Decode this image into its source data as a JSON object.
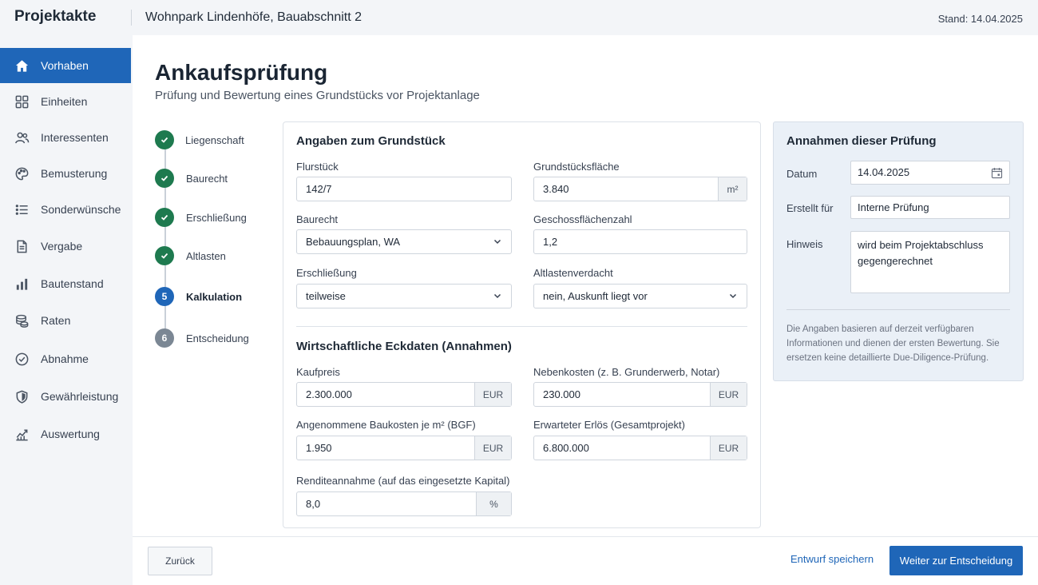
{
  "app": {
    "brand": "Projektakte",
    "project": "Wohnpark Lindenhöfe, Bauabschnitt 2",
    "stand": "Stand: 14.04.2025"
  },
  "sidebar": {
    "items": [
      {
        "label": "Vorhaben",
        "icon": "home-icon"
      },
      {
        "label": "Einheiten",
        "icon": "grid-icon"
      },
      {
        "label": "Interessenten",
        "icon": "users-icon"
      },
      {
        "label": "Bemusterung",
        "icon": "palette-icon"
      },
      {
        "label": "Sonderwünsche",
        "icon": "list-icon"
      },
      {
        "label": "Vergabe",
        "icon": "document-icon"
      },
      {
        "label": "Bautenstand",
        "icon": "bar-chart-icon"
      },
      {
        "label": "Raten",
        "icon": "coins-icon"
      },
      {
        "label": "Abnahme",
        "icon": "check-circle-icon"
      },
      {
        "label": "Gewährleistung",
        "icon": "shield-icon"
      },
      {
        "label": "Auswertung",
        "icon": "trend-icon"
      }
    ],
    "active_index": 0,
    "accent": "#1f66b8"
  },
  "page": {
    "title": "Ankaufsprüfung",
    "subtitle": "Prüfung und Bewertung eines Grundstücks vor Projektanlage"
  },
  "steps": [
    {
      "number": "1",
      "label": "Liegenschaft",
      "state": "done"
    },
    {
      "number": "2",
      "label": "Baurecht",
      "state": "done"
    },
    {
      "number": "3",
      "label": "Erschließung",
      "state": "done"
    },
    {
      "number": "4",
      "label": "Altlasten",
      "state": "done"
    },
    {
      "number": "5",
      "label": "Kalkulation",
      "state": "current"
    },
    {
      "number": "6",
      "label": "Entscheidung",
      "state": "todo"
    }
  ],
  "form": {
    "section1_title": "Angaben zum Grundstück",
    "flurstueck": {
      "label": "Flurstück",
      "value": "142/7"
    },
    "flaeche": {
      "label": "Grundstücksfläche",
      "value": "3.840",
      "unit": "m²"
    },
    "baurecht": {
      "label": "Baurecht",
      "value": "Bebauungsplan, WA"
    },
    "gfz": {
      "label": "Geschossflächenzahl",
      "value": "1,2"
    },
    "erschliessung": {
      "label": "Erschließung",
      "value": "teilweise"
    },
    "altlasten": {
      "label": "Altlastenverdacht",
      "value": "nein, Auskunft liegt vor"
    },
    "section2_title": "Wirtschaftliche Eckdaten (Annahmen)",
    "kaufpreis": {
      "label": "Kaufpreis",
      "value": "2.300.000",
      "unit": "EUR"
    },
    "nebenkosten": {
      "label": "Nebenkosten (z. B. Grunderwerb, Notar)",
      "value": "230.000",
      "unit": "EUR"
    },
    "baukosten": {
      "label": "Angenommene Baukosten je m² (BGF)",
      "value": "1.950",
      "unit": "EUR"
    },
    "erloes": {
      "label": "Erwarteter Erlös (Gesamtprojekt)",
      "value": "6.800.000",
      "unit": "EUR"
    },
    "rendite": {
      "label": "Renditeannahme (auf das eingesetzte Kapital)",
      "value": "8,0",
      "unit": "%"
    }
  },
  "assumptions": {
    "title": "Annahmen dieser Prüfung",
    "datum_label": "Datum",
    "datum_value": "14.04.2025",
    "erstellt_label": "Erstellt für",
    "erstellt_value": "Interne Prüfung",
    "hinweis_label": "Hinweis",
    "hinweis_value": "wird beim Projektabschluss gegengerechnet",
    "note": "Die Angaben basieren auf derzeit verfügbaren Informationen und dienen der ersten Bewertung. Sie ersetzen keine detaillierte Due-Diligence-Prüfung."
  },
  "footer": {
    "back": "Zurück",
    "draft": "Entwurf speichern",
    "next": "Weiter zur Entscheidung"
  }
}
